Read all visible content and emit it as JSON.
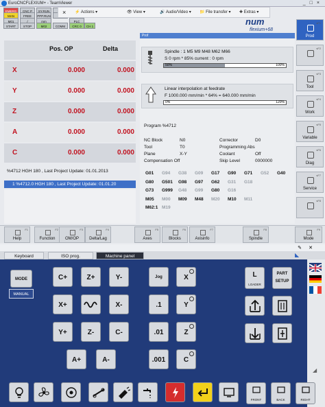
{
  "window": {
    "title": "EuroCNCFLEXIUM+ - TeamViewer",
    "min": "_",
    "max": "□",
    "close": "×"
  },
  "toolbar": {
    "close": "×",
    "actions": "Actions",
    "view": "View",
    "audio": "Audio/Video",
    "file": "File transfer",
    "extras": "Extras"
  },
  "status": [
    [
      "EMERG",
      "CNC P",
      "SY.RUN",
      "EXT"
    ],
    [
      "MAN",
      "FREE",
      "PPP.RUN",
      "WA"
    ],
    [
      "M01",
      "/",
      "mm",
      "PLC"
    ],
    [
      "START",
      "STOP",
      "M02",
      "COMM",
      "CRC 0",
      "CH 1"
    ]
  ],
  "logo": {
    "brand": "num",
    "product": "flexium+68"
  },
  "axes": {
    "headers": {
      "pos": "Pos. OP",
      "delta": "Delta"
    },
    "rows": [
      {
        "axis": "X",
        "pos": "0.000",
        "delta": "0.000"
      },
      {
        "axis": "Y",
        "pos": "0.000",
        "delta": "0.000"
      },
      {
        "axis": "Z",
        "pos": "0.000",
        "delta": "0.000"
      },
      {
        "axis": "A",
        "pos": "0.000",
        "delta": "0.000"
      },
      {
        "axis": "C",
        "pos": "0.000",
        "delta": "0.000"
      }
    ]
  },
  "program": {
    "line": "%4712 HGH 180 , Last Project Update: 01.01.2013",
    "selected": "1  %4712.0 HGH 180 , Last Project Update: 01.01.20"
  },
  "right": {
    "header": "Prof",
    "spindle": {
      "line1": "Spindle : 1     M5  M9  M48  M62  M66",
      "line2": "S 0 rpm * 85% current : 0 rpm",
      "bar_label": "50%",
      "bar_pct": "100%",
      "fill": 0.5
    },
    "interp": {
      "line1": "Linear interpolation at feedrate",
      "line2": "F 1000.000 mm/min * 64% = 640.000 mm/min",
      "bar_label": "0%",
      "bar_pct": "120%",
      "fill": 0.0
    },
    "program": "Program %4712",
    "info": [
      {
        "k": "NC Block",
        "v": "N0",
        "k2": "Corrector",
        "v2": "D0"
      },
      {
        "k": "Tool",
        "v": "T0",
        "k2": "Programming Abs",
        "v2": ""
      },
      {
        "k": "Plane",
        "v": "X-Y",
        "k2": "Coolant",
        "v2": "Off"
      },
      {
        "k": "Compensation Off",
        "v": "",
        "k2": "Skip Level",
        "v2": "0000000"
      }
    ],
    "gcodes": [
      [
        {
          "t": "G01",
          "on": true
        },
        {
          "t": "G94",
          "on": false
        },
        {
          "t": "G38",
          "on": false
        },
        {
          "t": "G09",
          "on": false
        },
        {
          "t": "G17",
          "on": true
        },
        {
          "t": "G90",
          "on": true
        },
        {
          "t": "G71",
          "on": true
        },
        {
          "t": "G52",
          "on": false
        },
        {
          "t": "G40",
          "on": true
        }
      ],
      [
        {
          "t": "G80",
          "on": true
        },
        {
          "t": "G501",
          "on": true
        },
        {
          "t": "G98",
          "on": true
        },
        {
          "t": "G97",
          "on": true
        },
        {
          "t": "G62",
          "on": true
        },
        {
          "t": "G31",
          "on": false
        },
        {
          "t": "G18",
          "on": false
        }
      ],
      [
        {
          "t": "G73",
          "on": true
        },
        {
          "t": "G999",
          "on": true
        },
        {
          "t": "G48",
          "on": false
        },
        {
          "t": "G99",
          "on": false
        },
        {
          "t": "G80",
          "on": true
        },
        {
          "t": "G16",
          "on": false
        }
      ],
      [
        {
          "t": "M05",
          "on": true
        },
        {
          "t": "M00",
          "on": false
        },
        {
          "t": "M09",
          "on": true
        },
        {
          "t": "M48",
          "on": true
        },
        {
          "t": "M20",
          "on": false
        },
        {
          "t": "M10",
          "on": true
        },
        {
          "t": "M11",
          "on": false
        }
      ],
      [
        {
          "t": "M62:1",
          "on": true
        },
        {
          "t": "M19",
          "on": false
        }
      ]
    ]
  },
  "rtabs": [
    {
      "label": "Prod",
      "fk": "sF1",
      "sel": true
    },
    {
      "label": "",
      "fk": "sF2",
      "sel": false
    },
    {
      "label": "Tool",
      "fk": "sF3",
      "sel": false
    },
    {
      "label": "Work",
      "fk": "sF4",
      "sel": false
    },
    {
      "label": "Variable",
      "fk": "sF5",
      "sel": false
    },
    {
      "label": "Diag",
      "fk": "sF6",
      "sel": false
    },
    {
      "label": "Service",
      "fk": "sF7",
      "sel": false
    },
    {
      "label": "",
      "fk": "sF8",
      "sel": false
    }
  ],
  "softkeys": [
    {
      "label": "Help",
      "fk": "F1"
    },
    {
      "label": "Function",
      "fk": "F2"
    },
    {
      "label": "OM/OP",
      "fk": "F3"
    },
    {
      "label": "Delta/Lag",
      "fk": "F4"
    },
    {
      "label": "Axes",
      "fk": "F5"
    },
    {
      "label": "Blocks",
      "fk": "F6"
    },
    {
      "label": "Axisinfo",
      "fk": "F7"
    },
    {
      "label": "Spindle",
      "fk": "F8"
    },
    {
      "label": "Mode",
      "fk": "F9"
    }
  ],
  "tabs": {
    "keyboard": "Keyboard",
    "iso": "ISO prog.",
    "panel": "Machine panel"
  },
  "panel": {
    "mode": "MODE",
    "manual": "MANUAL",
    "jog": [
      "C+",
      "Z+",
      "Y-",
      "X+",
      "X-",
      "Y+",
      "Z-",
      "C-",
      "A+",
      "A-"
    ],
    "jog_label": "Jog",
    "incr": [
      ".1",
      ".01",
      ".001"
    ],
    "incr_axes": [
      "X",
      "Y",
      "Z",
      "C"
    ],
    "loader": "LOADER",
    "loader_key": "L",
    "part_setup": "PART SETUP",
    "front": "FRONT",
    "back": "BACK",
    "right": "RIGHT"
  }
}
